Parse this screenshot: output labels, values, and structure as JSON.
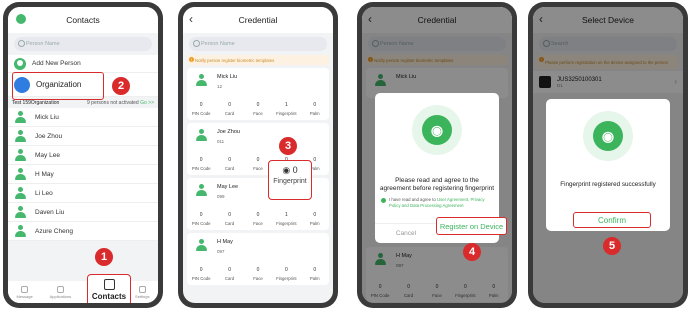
{
  "panel1": {
    "title": "Contacts",
    "search_placeholder": "Person Name",
    "add_new": "Add New Person",
    "organization": "Organization",
    "org_name": "Test 159Organization",
    "not_activated": "9 persons not activated",
    "go": "Go >>",
    "people": [
      "Mick Liu",
      "Joe Zhou",
      "May Lee",
      "H May",
      "Li Leo",
      "Daven Liu",
      "Azure Cheng"
    ],
    "nav": [
      "Message",
      "Applications",
      "Contacts",
      "Settings"
    ],
    "step_a": "2",
    "step_b": "1"
  },
  "panel2": {
    "title": "Credential",
    "search_placeholder": "Person Name",
    "notice": "Notify person register biometric templates",
    "cred_labels": [
      "PIN Code",
      "Card",
      "Face",
      "Fingerprint",
      "Palm"
    ],
    "persons": [
      {
        "name": "Mick Liu",
        "id": "12",
        "values": [
          "0",
          "0",
          "0",
          "1",
          "0"
        ]
      },
      {
        "name": "Joe Zhou",
        "id": "011",
        "values": [
          "0",
          "0",
          "0",
          "0",
          "0"
        ]
      },
      {
        "name": "May Lee",
        "id": "099",
        "values": [
          "0",
          "0",
          "0",
          "1",
          "0"
        ]
      },
      {
        "name": "H May",
        "id": "097",
        "values": [
          "0",
          "0",
          "0",
          "0",
          "0"
        ]
      }
    ],
    "zoom_value": "0",
    "zoom_label": "Fingerprint",
    "step": "3"
  },
  "panel3": {
    "title": "Credential",
    "search_placeholder": "Person Name",
    "notice": "Notify person register biometric templates",
    "person_top": "Mick Liu",
    "dialog_text": "Please read and agree to the agreement before registering fingerprint",
    "agree_prefix": "I have read and agree to ",
    "agree_link": "User Agreement, Privacy Policy and Data Processing Agreement",
    "cancel": "Cancel",
    "register": "Register on Device",
    "person_bottom": "H May",
    "person_bottom_id": "097",
    "cred_labels": [
      "PIN Code",
      "Card",
      "Face",
      "Fingerprint",
      "Palm"
    ],
    "cred_values": [
      "0",
      "0",
      "0",
      "0",
      "0"
    ],
    "step": "4"
  },
  "panel4": {
    "title": "Select Device",
    "search_placeholder": "Search",
    "notice": "Please perform registration on the device assigned to the person",
    "device": "JUS3250100301",
    "device_sub": "D1",
    "success_text": "Fingerprint registered successfully",
    "confirm": "Confirm",
    "step": "5"
  },
  "colors": {
    "accent": "#45b86e",
    "marker": "#d92b2b",
    "link": "#3cb45c",
    "warning": "#f09a24"
  }
}
